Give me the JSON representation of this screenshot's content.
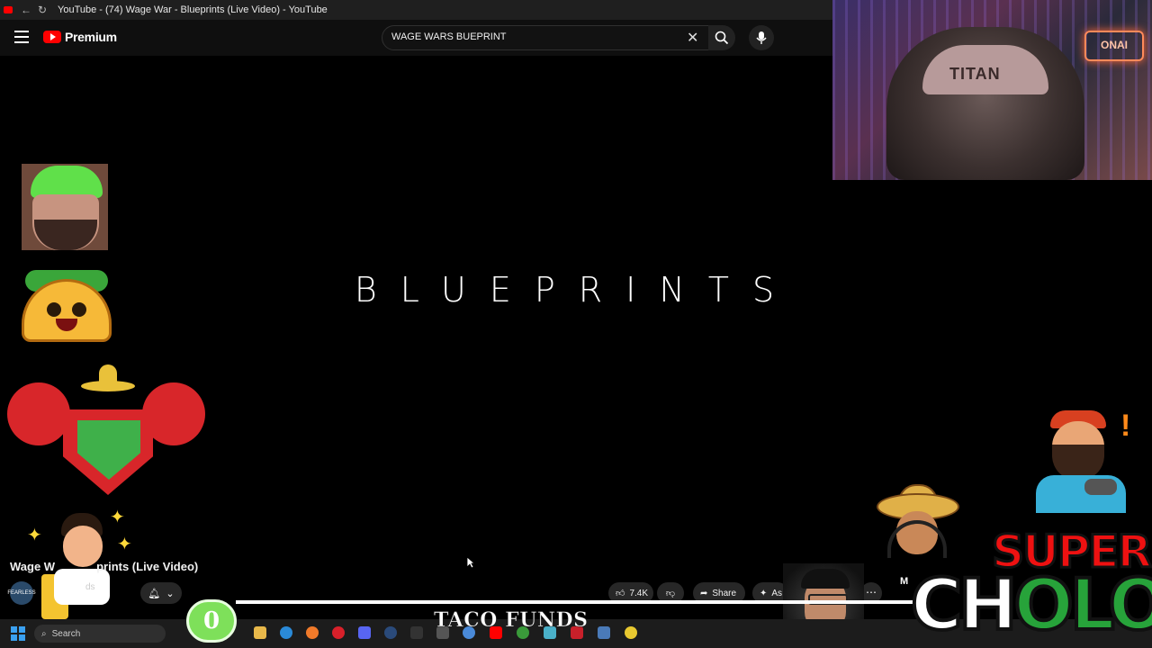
{
  "browser": {
    "tab_title": "YouTube - (74) Wage War - Blueprints (Live Video) - YouTube"
  },
  "youtube": {
    "logo_text": "Premium",
    "search_value": "WAGE WARS BUEPRINT",
    "video_overlay_text": "BLUEPRINTS",
    "video_title_visible": "Wage W",
    "video_title_rest": "prints (Live Video)",
    "channel_badge": "FEARLESS",
    "channel_name_visible": "ds",
    "likes": "7.4K",
    "share_label": "Share",
    "ask_label": "As",
    "rec_label": "M"
  },
  "stream_overlay": {
    "counter_value": "0",
    "banner_text": "TACO FUNDS",
    "brand_line1": "SUPER",
    "brand_line2_a": "CH",
    "brand_line2_b": "OLO",
    "cam_hat_text": "TITAN",
    "cam_sign_text": "ONAI"
  },
  "taskbar": {
    "search_placeholder": "Search",
    "app_icons": [
      "file-explorer-icon",
      "edge-icon",
      "firefox-icon",
      "opera-icon",
      "discord-icon",
      "steam-icon",
      "epic-icon",
      "app-icon",
      "chrome-icon",
      "youtube-icon",
      "xbox-icon",
      "notepad-icon",
      "app2-icon",
      "app3-icon",
      "chrome-icon"
    ]
  },
  "colors": {
    "youtube_red": "#ff0000",
    "background": "#000000",
    "counter_green": "#7ee05a",
    "super_red": "#e11111",
    "cholo_green": "#27a33a"
  }
}
